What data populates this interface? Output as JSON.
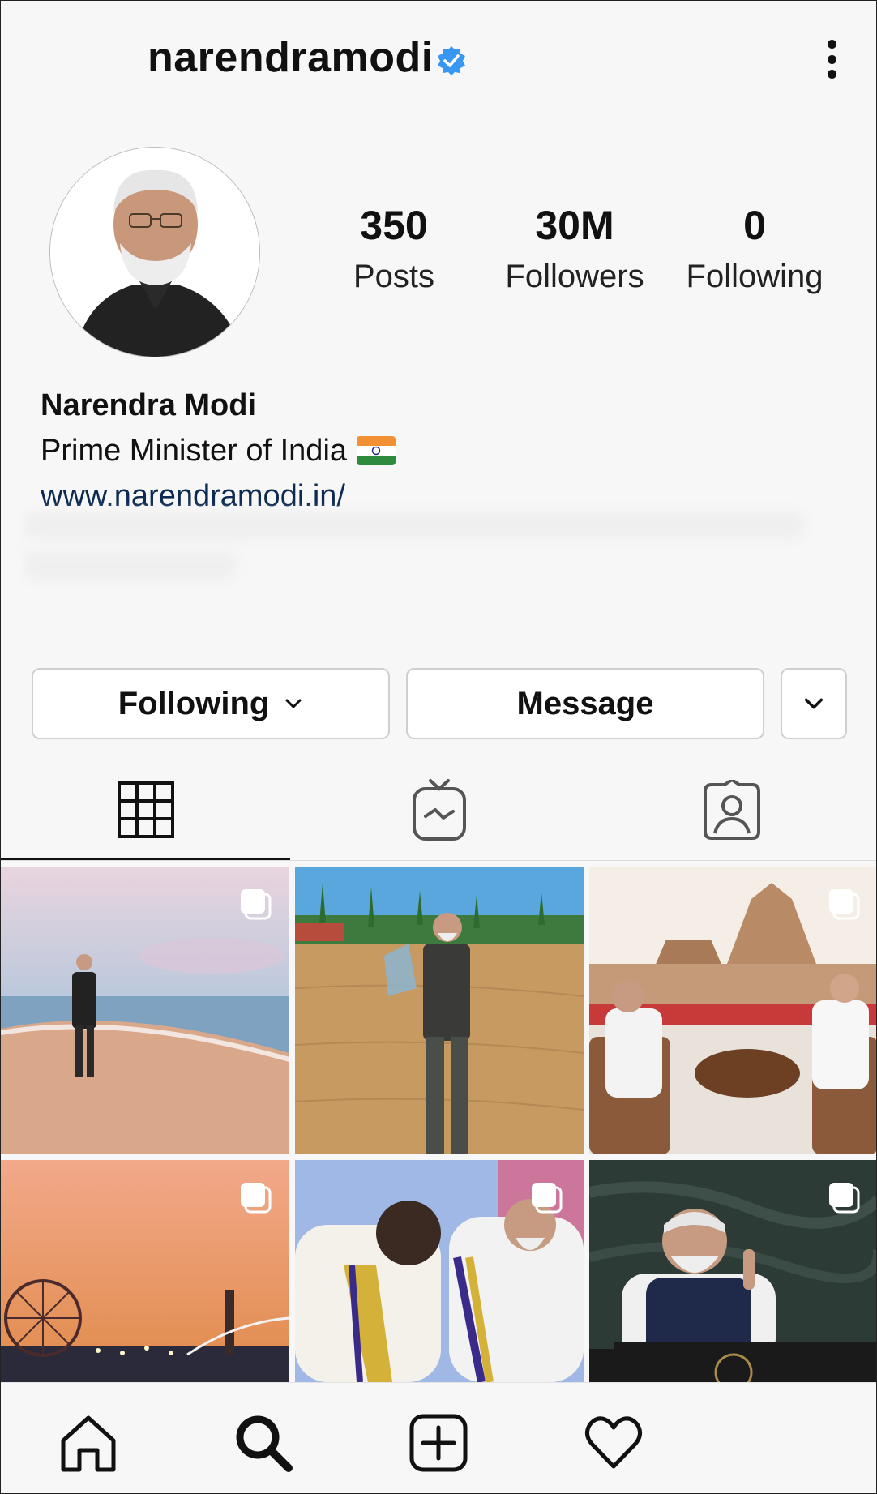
{
  "header": {
    "username": "narendramodi",
    "verified_icon": "verified-badge-icon",
    "more_icon": "more-vertical-icon"
  },
  "profile": {
    "avatar_icon": "profile-avatar",
    "stats": {
      "posts": {
        "value": "350",
        "label": "Posts"
      },
      "followers": {
        "value": "30M",
        "label": "Followers"
      },
      "following": {
        "value": "0",
        "label": "Following"
      }
    }
  },
  "bio": {
    "name": "Narendra Modi",
    "description": "Prime Minister of India",
    "link": "www.narendramodi.in/"
  },
  "actions": {
    "following_label": "Following",
    "message_label": "Message"
  },
  "tabs": [
    "grid-icon",
    "igtv-icon",
    "tagged-icon"
  ],
  "bottom_nav": [
    "home-icon",
    "search-icon",
    "add-post-icon",
    "heart-icon"
  ],
  "colors": {
    "background": "#f7f7f7",
    "verified_blue": "#3897f0",
    "link": "#0d2b52",
    "text": "#111111",
    "button_border": "#cfcfcf"
  }
}
